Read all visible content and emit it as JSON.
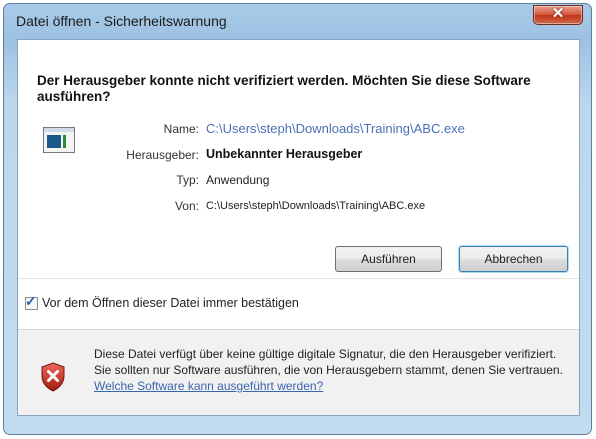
{
  "window": {
    "title": "Datei öffnen - Sicherheitswarnung",
    "close_symbol": "✕"
  },
  "dialog": {
    "heading": "Der Herausgeber konnte nicht verifiziert werden. Möchten Sie diese Software ausführen?",
    "app_icon": "executable-file-icon",
    "fields": {
      "name_label": "Name:",
      "name_value": "C:\\Users\\steph\\Downloads\\Training\\ABC.exe",
      "publisher_label": "Herausgeber:",
      "publisher_value": "Unbekannter Herausgeber",
      "type_label": "Typ:",
      "type_value": "Anwendung",
      "from_label": "Von:",
      "from_value": "C:\\Users\\steph\\Downloads\\Training\\ABC.exe"
    },
    "buttons": {
      "run": "Ausführen",
      "cancel": "Abbrechen"
    },
    "checkbox": {
      "label": "Vor dem Öffnen dieser Datei immer bestätigen",
      "checked": true
    },
    "warning": {
      "icon": "red-shield-x-icon",
      "text": "Diese Datei verfügt über keine gültige digitale Signatur, die den Herausgeber verifiziert. Sie sollten nur Software ausführen, die von Herausgebern stammt, denen Sie vertrauen.",
      "link": "Welche Software kann ausgeführt werden?"
    }
  },
  "colors": {
    "link": "#4a70b6",
    "frame": "#a9cbe8",
    "close_button": "#c8472a"
  }
}
